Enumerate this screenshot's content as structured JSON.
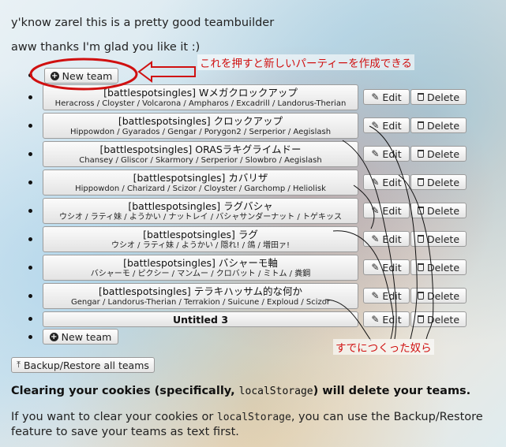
{
  "messages": [
    "y'know zarel this is a pretty good teambuilder",
    "aww thanks I'm glad you like it :)"
  ],
  "new_team_label": "New team",
  "edit_label": "Edit",
  "delete_label": "Delete",
  "teams": [
    {
      "name": "[battlespotsingles] Wメガクロックアップ",
      "pokemon": "Heracross / Cloyster / Volcarona / Ampharos / Excadrill / Landorus-Therian"
    },
    {
      "name": "[battlespotsingles] クロックアップ",
      "pokemon": "Hippowdon / Gyarados / Gengar / Porygon2 / Serperior / Aegislash"
    },
    {
      "name": "[battlespotsingles] ORASラキグライムドー",
      "pokemon": "Chansey / Gliscor / Skarmory / Serperior / Slowbro / Aegislash"
    },
    {
      "name": "[battlespotsingles] カバリザ",
      "pokemon": "Hippowdon / Charizard / Scizor / Cloyster / Garchomp / Heliolisk"
    },
    {
      "name": "[battlespotsingles] ラグバシャ",
      "pokemon": "ウシオ / ラティ妹 / ようかい / ナットレイ / バシャサンダーナット / トゲキッス"
    },
    {
      "name": "[battlespotsingles] ラグ",
      "pokemon": "ウシオ / ラティ妹 / ようかい / 隠れ! / 鴿 / 増田ァ!"
    },
    {
      "name": "[battlespotsingles] バシャーモ軸",
      "pokemon": "バシャーモ / ピクシー / マンムー / クロバット / ミトム / 粪鋼"
    },
    {
      "name": "[battlespotsingles] テラキハッサム的な何か",
      "pokemon": "Gengar / Landorus-Therian / Terrakion / Suicune / Exploud / Scizor"
    },
    {
      "name": "Untitled 3",
      "pokemon": ""
    }
  ],
  "backup_label": "Backup/Restore all teams",
  "warning": {
    "pre": "Clearing your cookies (specifically, ",
    "code": "localStorage",
    "post": ") will delete your teams."
  },
  "info": {
    "pre": "If you want to clear your cookies or ",
    "code": "localStorage",
    "post": ", you can use the Backup/Restore feature to save your teams as text first."
  },
  "annotations": {
    "new_team_note": "これを押すと新しいパーティーを作成できる",
    "existing_note": "すでにつくった奴ら"
  },
  "colors": {
    "annotation": "#d01010"
  }
}
